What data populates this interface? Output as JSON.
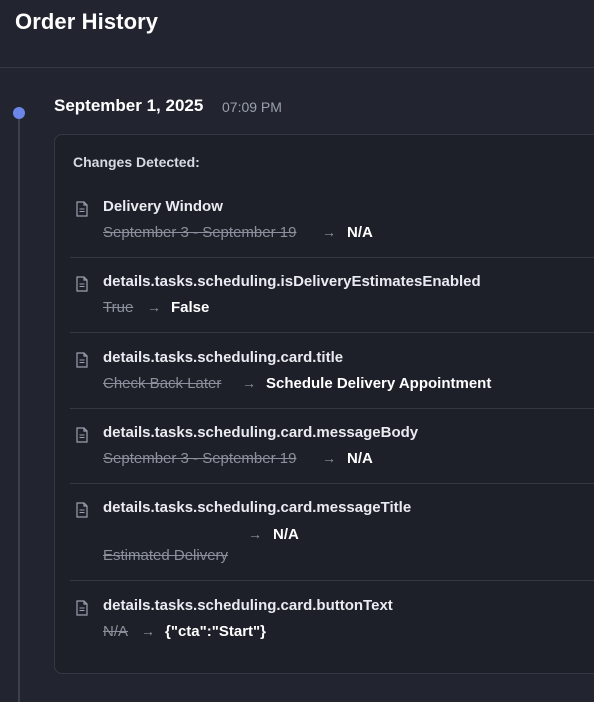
{
  "page": {
    "title": "Order History"
  },
  "entry": {
    "date": "September 1, 2025",
    "time": "07:09 PM",
    "changes_heading": "Changes Detected:",
    "arrow_glyph": "→",
    "changes": [
      {
        "field": "Delivery Window",
        "old": "September 3 - September 19",
        "new": "N/A",
        "icon": "document-icon"
      },
      {
        "field": "details.tasks.scheduling.isDeliveryEstimatesEnabled",
        "old": "True",
        "new": "False",
        "icon": "document-icon"
      },
      {
        "field": "details.tasks.scheduling.card.title",
        "old": "Check Back Later",
        "new": "Schedule Delivery Appointment",
        "icon": "document-icon"
      },
      {
        "field": "details.tasks.scheduling.card.messageBody",
        "old": "September 3 - September 19",
        "new": "N/A",
        "icon": "document-icon"
      },
      {
        "field": "details.tasks.scheduling.card.messageTitle",
        "old": "Estimated Delivery",
        "new": "N/A",
        "icon": "document-icon"
      },
      {
        "field": "details.tasks.scheduling.card.buttonText",
        "old": "N/A",
        "new": "{\"cta\":\"Start\"}",
        "icon": "document-icon"
      }
    ]
  },
  "colors": {
    "background": "#22252f",
    "card": "#1d2029",
    "timeline_dot": "#6b86e8"
  }
}
